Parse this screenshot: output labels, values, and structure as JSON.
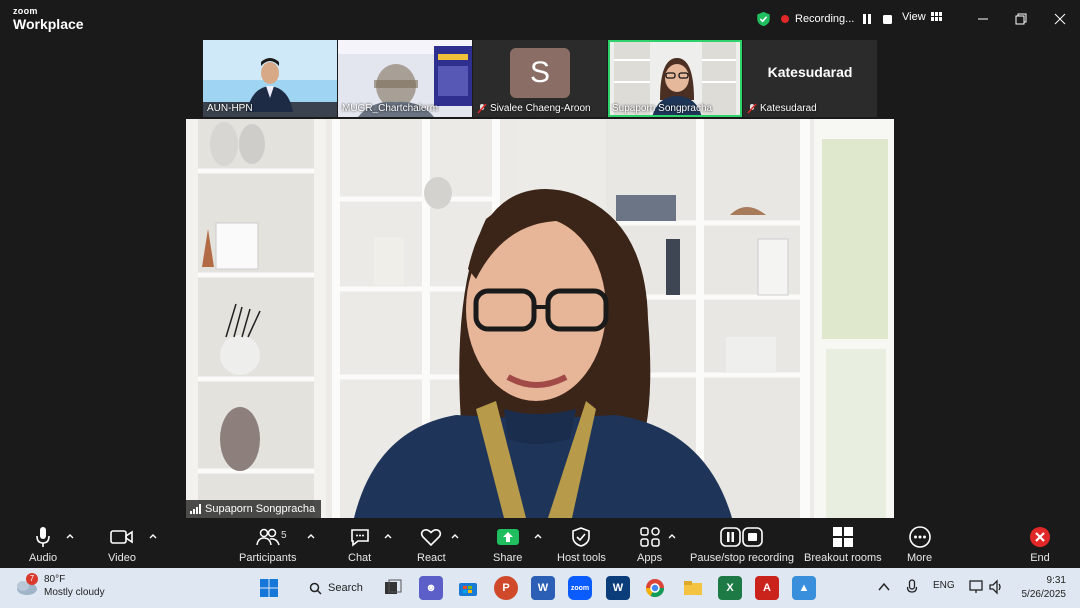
{
  "app": {
    "logo_top": "zoom",
    "logo_bottom": "Workplace"
  },
  "recording": {
    "status": "Recording..."
  },
  "view": {
    "label": "View"
  },
  "thumbnails": [
    {
      "name": "AUN-HPN",
      "muted": false
    },
    {
      "name": "MUGR_Chartchalerm",
      "muted": false
    },
    {
      "name": "Sivalee Chaeng-Aroon",
      "muted": true,
      "initial": "S"
    },
    {
      "name": "Supaporn Songpracha",
      "muted": false,
      "active": true
    },
    {
      "name": "Katesudarad",
      "muted": true,
      "display_text": "Katesudarad"
    }
  ],
  "main_video": {
    "speaker_name": "Supaporn Songpracha"
  },
  "toolbar": {
    "audio": "Audio",
    "video": "Video",
    "participants": "Participants",
    "participants_count": "5",
    "chat": "Chat",
    "react": "React",
    "share": "Share",
    "host_tools": "Host tools",
    "apps": "Apps",
    "pause_recording": "Pause/stop recording",
    "breakout": "Breakout rooms",
    "more": "More",
    "end": "End"
  },
  "taskbar": {
    "weather_badge": "7",
    "temperature": "80°F",
    "condition": "Mostly cloudy",
    "search": "Search",
    "language": "ENG",
    "time": "9:31",
    "date": "5/26/2025"
  },
  "colors": {
    "accent_green": "#2fd36b",
    "rec_red": "#e02828",
    "end_red": "#e02828",
    "share_green": "#1fbf5f"
  }
}
